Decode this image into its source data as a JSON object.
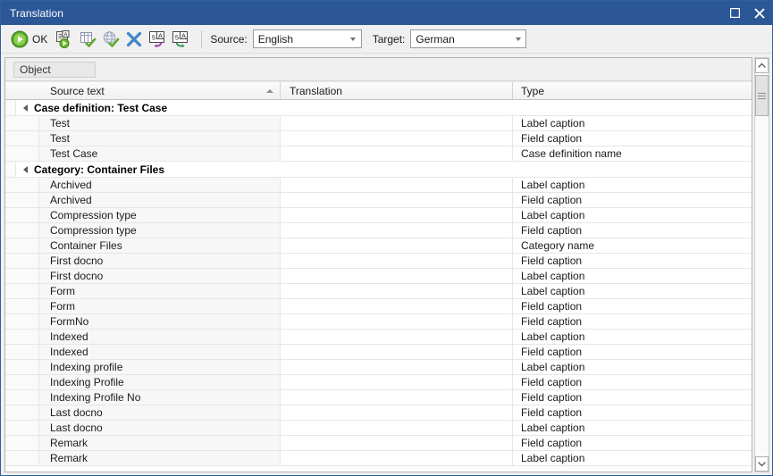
{
  "window": {
    "title": "Translation",
    "maximize_label": "Maximize",
    "close_label": "Close",
    "accent_color": "#2b5797",
    "titlebar_text_color": "#ffffff"
  },
  "toolbar": {
    "ok_label": "OK",
    "buttons": [
      {
        "name": "ok-button",
        "label": "OK",
        "icon": "play-circle-icon"
      },
      {
        "name": "translate-object-button",
        "label": "",
        "icon": "translate-run-icon"
      },
      {
        "name": "translate-grid-button",
        "label": "",
        "icon": "grid-check-icon"
      },
      {
        "name": "translate-global-button",
        "label": "",
        "icon": "globe-check-icon"
      },
      {
        "name": "delete-translation-button",
        "label": "",
        "icon": "delete-x-icon"
      },
      {
        "name": "import-translation-button",
        "label": "",
        "icon": "import-translation-icon"
      },
      {
        "name": "export-translation-button",
        "label": "",
        "icon": "export-translation-icon"
      }
    ],
    "source": {
      "label": "Source:",
      "value": "English"
    },
    "target": {
      "label": "Target:",
      "value": "German"
    }
  },
  "grid": {
    "group_band_chip": "Object",
    "columns": [
      {
        "key": "source",
        "label": "Source text",
        "sorted": "asc"
      },
      {
        "key": "translation",
        "label": "Translation",
        "sorted": "none"
      },
      {
        "key": "type",
        "label": "Type",
        "sorted": "none"
      }
    ],
    "groups": [
      {
        "title": "Case definition: Test Case",
        "expanded": true,
        "rows": [
          {
            "source": "Test",
            "translation": "",
            "type": "Label caption"
          },
          {
            "source": "Test",
            "translation": "",
            "type": "Field caption"
          },
          {
            "source": "Test Case",
            "translation": "",
            "type": "Case definition name"
          }
        ]
      },
      {
        "title": "Category: Container Files",
        "expanded": true,
        "rows": [
          {
            "source": "Archived",
            "translation": "",
            "type": "Label caption"
          },
          {
            "source": "Archived",
            "translation": "",
            "type": "Field caption"
          },
          {
            "source": "Compression type",
            "translation": "",
            "type": "Label caption"
          },
          {
            "source": "Compression type",
            "translation": "",
            "type": "Field caption"
          },
          {
            "source": "Container Files",
            "translation": "",
            "type": "Category name"
          },
          {
            "source": "First docno",
            "translation": "",
            "type": "Field caption"
          },
          {
            "source": "First docno",
            "translation": "",
            "type": "Label caption"
          },
          {
            "source": "Form",
            "translation": "",
            "type": "Label caption"
          },
          {
            "source": "Form",
            "translation": "",
            "type": "Field caption"
          },
          {
            "source": "FormNo",
            "translation": "",
            "type": "Field caption"
          },
          {
            "source": "Indexed",
            "translation": "",
            "type": "Label caption"
          },
          {
            "source": "Indexed",
            "translation": "",
            "type": "Field caption"
          },
          {
            "source": "Indexing profile",
            "translation": "",
            "type": "Label caption"
          },
          {
            "source": "Indexing Profile",
            "translation": "",
            "type": "Field caption"
          },
          {
            "source": "Indexing Profile No",
            "translation": "",
            "type": "Field caption"
          },
          {
            "source": "Last docno",
            "translation": "",
            "type": "Field caption"
          },
          {
            "source": "Last docno",
            "translation": "",
            "type": "Label caption"
          },
          {
            "source": "Remark",
            "translation": "",
            "type": "Field caption"
          },
          {
            "source": "Remark",
            "translation": "",
            "type": "Label caption"
          }
        ]
      }
    ]
  },
  "scrollbar": {
    "up_label": "Scroll up",
    "down_label": "Scroll down"
  }
}
